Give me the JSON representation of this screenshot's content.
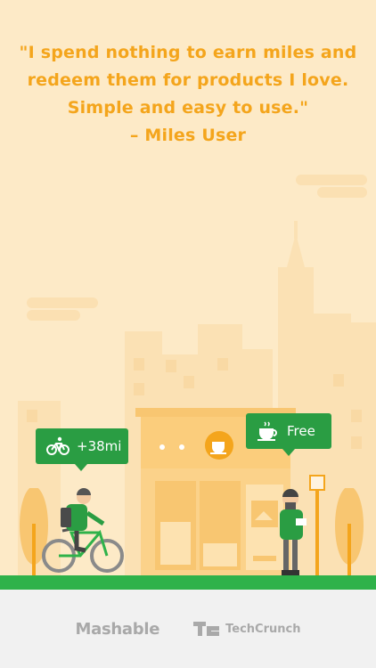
{
  "quote": {
    "line1": "\"I spend nothing to earn miles and",
    "line2": "redeem them for products I love.",
    "line3": "Simple and easy to use.\"",
    "attribution": "– Miles User"
  },
  "bubbles": {
    "miles": {
      "icon": "bicycle-icon",
      "label": "+38mi"
    },
    "free": {
      "icon": "coffee-cup-icon",
      "label": "Free"
    }
  },
  "footer": {
    "logos": [
      "Mashable",
      "TechCrunch"
    ]
  },
  "colors": {
    "background": "#fdeac7",
    "accent_text": "#f4a51c",
    "bubble_green": "#2a9d43",
    "ground_green": "#2fb24a",
    "footer_bg": "#f1f1f1",
    "logo_gray": "#a9a9a9"
  }
}
